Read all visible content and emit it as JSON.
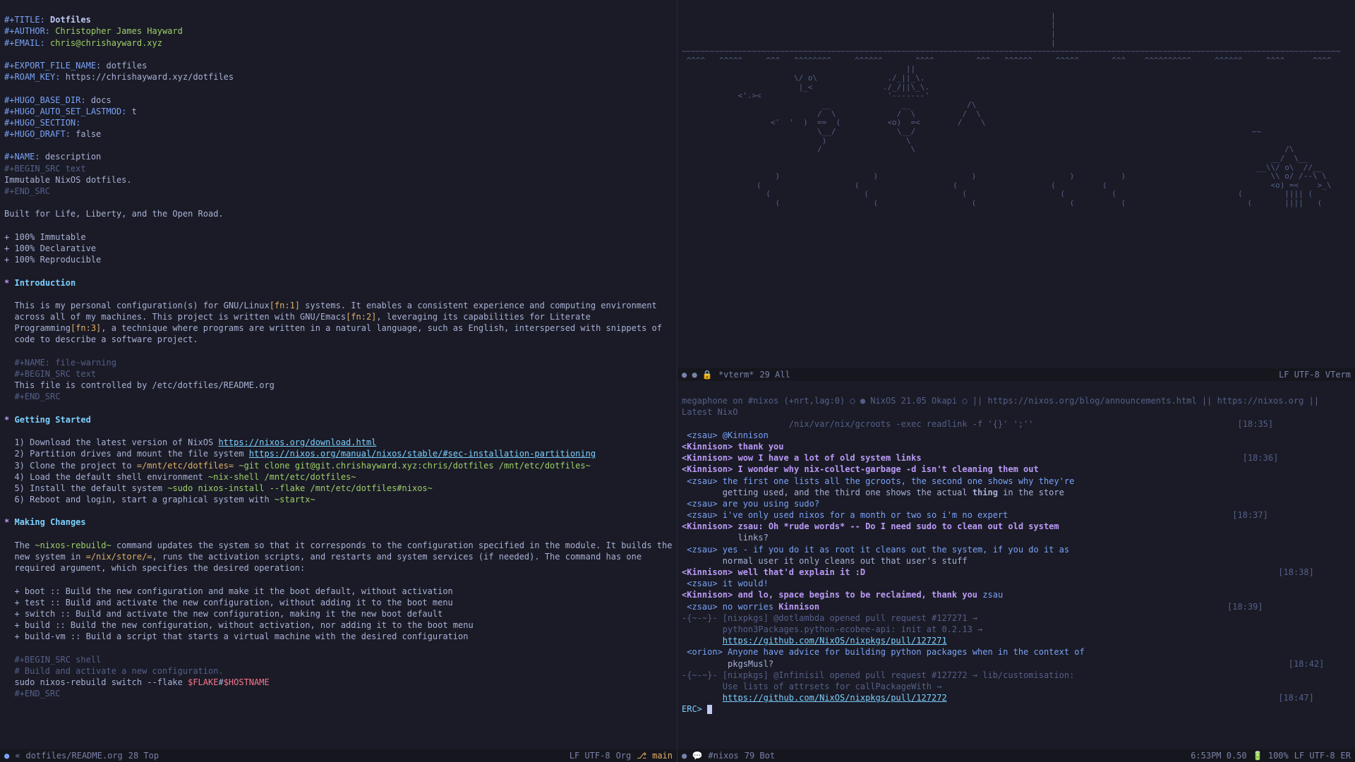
{
  "editor": {
    "title_key": "#+TITLE:",
    "title_val": "Dotfiles",
    "author_key": "#+AUTHOR:",
    "author_val": "Christopher James Hayward",
    "email_key": "#+EMAIL:",
    "email_val": "chris@chrishayward.xyz",
    "export_key": "#+EXPORT_FILE_NAME:",
    "export_val": "dotfiles",
    "roam_key": "#+ROAM_KEY:",
    "roam_val": "https://chrishayward.xyz/dotfiles",
    "hugo_base_key": "#+HUGO_BASE_DIR:",
    "hugo_base_val": "docs",
    "hugo_lastmod_key": "#+HUGO_AUTO_SET_LASTMOD:",
    "hugo_lastmod_val": "t",
    "hugo_section_key": "#+HUGO_SECTION:",
    "hugo_draft_key": "#+HUGO_DRAFT:",
    "hugo_draft_val": "false",
    "name_desc_key": "#+NAME:",
    "name_desc_val": "description",
    "begin_src_text": "#+BEGIN_SRC text",
    "desc_body": "Immutable NixOS dotfiles.",
    "end_src": "#+END_SRC",
    "tagline": "Built for Life, Liberty, and the Open Road.",
    "bullets": [
      "+ 100% Immutable",
      "+ 100% Declarative",
      "+ 100% Reproducible"
    ],
    "h_intro": "Introduction",
    "intro_p1a": "This is my personal configuration(s) for GNU/Linux",
    "fn1": "[fn:1]",
    "intro_p1b": " systems. It enables a consistent experience and computing environment",
    "intro_p2a": "across all of my machines. This project is written with GNU/Emacs",
    "fn2": "[fn:2]",
    "intro_p2b": ", leveraging its capabilities for Literate",
    "intro_p3a": "Programming",
    "fn3": "[fn:3]",
    "intro_p3b": ", a technique where programs are written in a natural language, such as English, interspersed with snippets of",
    "intro_p4": "code to describe a software project.",
    "name_fw_key": "#+NAME:",
    "name_fw_val": "file-warning",
    "begin_src_text2": "#+BEGIN_SRC text",
    "fw_body": "This file is controlled by /etc/dotfiles/README.org",
    "end_src2": "#+END_SRC",
    "h_getting": "Getting Started",
    "gs1a": "1) Download the latest version of NixOS ",
    "gs1url": "https://nixos.org/download.html",
    "gs2a": "2) Partition drives and mount the file system ",
    "gs2url": "https://nixos.org/manual/nixos/stable/#sec-installation-partitioning",
    "gs3a": "3) Clone the project to ",
    "gs3b": "=/mnt/etc/dotfiles=",
    "gs3c": " ~git clone git@git.chrishayward.xyz:chris/dotfiles /mnt/etc/dotfiles~",
    "gs4a": "4) Load the default shell environment ",
    "gs4b": "~nix-shell /mnt/etc/dotfiles~",
    "gs5a": "5) Install the default system ",
    "gs5b": "~sudo nixos-install --flake /mnt/etc/dotfiles#nixos~",
    "gs6a": "6) Reboot and login, start a graphical system with ",
    "gs6b": "~startx~",
    "h_making": "Making Changes",
    "mc_p1a": "The ",
    "mc_p1b": "~nixos-rebuild~",
    "mc_p1c": " command updates the system so that it corresponds to the configuration specified in the module. It builds the",
    "mc_p2a": "new system in ",
    "mc_p2b": "=/nix/store/=",
    "mc_p2c": ", runs the activation scripts, and restarts and system services (if needed). The command has one",
    "mc_p3": "required argument, which specifies the desired operation:",
    "mc_b1": "+ boot :: Build the new configuration and make it the boot default, without activation",
    "mc_b2": "+ test :: Build and activate the new configuration, without adding it to the boot menu",
    "mc_b3": "+ switch :: Build and activate the new configuration, making it the new boot default",
    "mc_b4": "+ build :: Build the new configuration, without activation, nor adding it to the boot menu",
    "mc_b5": "+ build-vm :: Build a script that starts a virtual machine with the desired configuration",
    "begin_src_shell": "#+BEGIN_SRC shell",
    "sh_cmt": "# Build and activate a new configuration.",
    "sh_line_a": "sudo nixos-rebuild switch --flake ",
    "sh_flake": "$FLAKE",
    "sh_hash": "#",
    "sh_host": "$HOSTNAME",
    "end_src3": "#+END_SRC"
  },
  "modeline_left": {
    "circle": "●",
    "chev": "«",
    "file": "dotfiles/README.org",
    "pos": "28 Top",
    "enc": "LF UTF-8",
    "mode": "Org",
    "branch_icon": "⎇",
    "branch": "main"
  },
  "term_modeline": {
    "dots": "● ● 🔒",
    "name": "*vterm*",
    "pos": "29 All",
    "enc": "LF UTF-8",
    "mode": "VTerm"
  },
  "irc": {
    "topic_a": "megaphone on #nixos (+nrt,lag:0) ○ ● NixOS 21.05 Okapi ○ || https://nixos.org/blog/announcements.html || https://nixos.org || Latest NixO",
    "topic_b": "                     /nix/var/nix/gcroots -exec readlink -f '{}' ';''",
    "ts1": "[18:35]",
    "l1": " <zsau> @Kinnison",
    "l2": "<Kinnison> thank you",
    "l3": "<Kinnison> wow I have a lot of old system links",
    "ts2": "[18:36]",
    "l4": "<Kinnison> I wonder why nix-collect-garbage -d isn't cleaning them out",
    "l5a": " <zsau> the first one lists all the gcroots, the second one shows why they're",
    "l5b": "        getting used, and the third one shows the actual ",
    "l5c": "thing",
    "l5d": " in the store",
    "l6": " <zsau> are you using sudo?",
    "l7": " <zsau> i've only used nixos for a month or two so i'm no expert",
    "ts3": "[18:37]",
    "l8a": "<Kinnison> zsau: Oh *rude words* -- Do I need sudo to clean out old system",
    "l8b": "           links?",
    "l9a": " <zsau> yes - if you do it as root it cleans out the system, if you do it as",
    "l9b": "        normal user it only cleans out that user's stuff",
    "l10": "<Kinnison> well that'd explain it :D",
    "ts4": "[18:38]",
    "l11": " <zsau> it would!",
    "l12a": "<Kinnison> and lo, space begins to be reclaimed, thank you ",
    "l12b": "zsau",
    "l13a": " <zsau> no worries ",
    "l13b": "Kinnison",
    "ts5": "[18:39]",
    "l14a": "-{~-~}- [nixpkgs] @dotlambda opened pull request #127271 →",
    "l14b": "        python3Packages.python-ecobee-api: init at 0.2.13 →",
    "l14url": "https://github.com/NixOS/nixpkgs/pull/127271",
    "l15a": " <orion> Anyone have advice for building python packages when in the context of",
    "l15b": "         pkgsMusl?",
    "ts6": "[18:42]",
    "l16a": "-{~-~}- [nixpkgs] @Infinisil opened pull request #127272 → lib/customisation:",
    "l16b": "        Use lists of attrsets for callPackageWith →",
    "l16url": "https://github.com/NixOS/nixpkgs/pull/127272",
    "ts7": "[18:47]",
    "prompt": "ERC> "
  },
  "irc_modeline": {
    "dots": "● 💬",
    "name": "#nixos",
    "pos": "79 Bot",
    "time": "6:53PM 0.50",
    "batt": "🔋 100%",
    "enc": "LF UTF-8",
    "mode": "ER"
  },
  "ascii": {
    "l1": "                                                                               |",
    "l2": "                                                                               |",
    "l3": "                                                                               |",
    "l4": "                                                                               |",
    "l5": "~~~~~~~~~~~~~~~~~~~~~~~~~~~~~~~~~~~~~~~~~~~~~~~~~~~~~~~~~~~~~~~~~~~~~~~~~~~~~~~~~~~~~~~~~~~~~~~~~~~~~~~~~~~~~~~~~~~~~~~~~~~~~~~~~~~~~~~~~~~~~",
    "l6": " ^^^^   ^^^^^     ^^^   ^^^^^^^^     ^^^^^^       ^^^^         ^^^   ^^^^^^     ^^^^^       ^^^    ^^^^^^^^^^     ^^^^^^     ^^^^      ^^^^ ",
    "l7": "                                                ||",
    "l8": "                        \\/ o\\               ./_||_\\.",
    "l9": "                         |_<               ./_/||\\_\\.",
    "l10": "            <'.><                           '-------'",
    "l11": "                              __               __            /\\",
    "l12": "                             /  \\             /  \\          /  \\",
    "l13": "                   <'  '  )  ==  (          <o)  =<        /    \\",
    "l14": "                             \\__/             \\__/                                                                        ~~",
    "l15": "                              )                 \\",
    "l16": "                             /                   \\                                                                               /\\",
    "l17": "                                                                                                                              __/  \\__",
    "l18": "                                                                                                                           __\\\\/ o\\  //__",
    "l19": "                    )                    )                    )                    )          )                               \\\\ o/ /--\\ \\",
    "l20": "                (                    (                    (                    (          (                                   <o) =<    >_\\",
    "l21": "                  (                    (                    (                    (          (                          (         |||| (",
    "l22": "                    (                    (                    (                    (          (                          (       ||||   ("
  }
}
